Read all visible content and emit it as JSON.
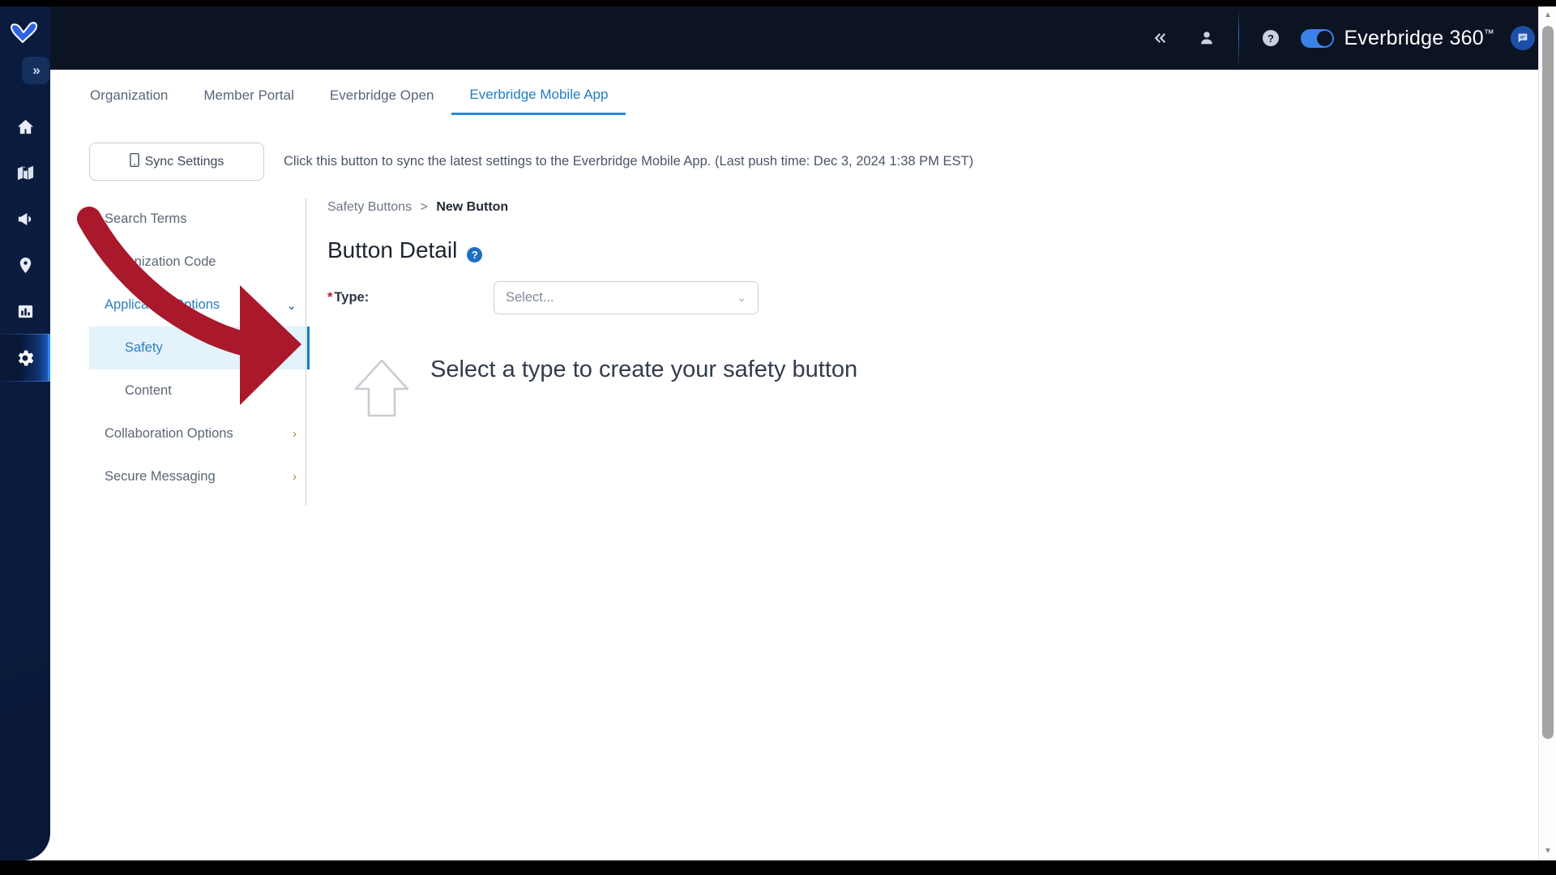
{
  "header": {
    "collapse_icon": "chevron-double-left-icon",
    "user_icon": "user-icon",
    "help_icon": "question-circle-icon",
    "brand_label": "Everbridge 360",
    "brand_sup": "™",
    "chat_icon": "chat-bubble-icon",
    "toggle_state": "on"
  },
  "rail": {
    "logo": "everbridge-logo",
    "expand_label": "»",
    "items": [
      {
        "name": "home-icon",
        "active": false
      },
      {
        "name": "map-icon",
        "active": false
      },
      {
        "name": "megaphone-icon",
        "active": false
      },
      {
        "name": "location-pin-icon",
        "active": false
      },
      {
        "name": "bar-chart-icon",
        "active": false
      },
      {
        "name": "gear-icon",
        "active": true
      }
    ]
  },
  "tabs": [
    {
      "label": "Organization",
      "active": false
    },
    {
      "label": "Member Portal",
      "active": false
    },
    {
      "label": "Everbridge Open",
      "active": false
    },
    {
      "label": "Everbridge Mobile App",
      "active": true
    }
  ],
  "sync": {
    "button_label": "Sync Settings",
    "button_icon": "mobile-phone-icon",
    "note": "Click this button to sync the latest settings to the Everbridge Mobile App. (Last push time: Dec 3, 2024 1:38 PM EST)"
  },
  "subnav": {
    "items": [
      {
        "label": "Search Terms",
        "type": "item",
        "chevron": ""
      },
      {
        "label": "Organization Code",
        "type": "item",
        "chevron": ""
      },
      {
        "label": "Application Options",
        "type": "parent-open",
        "chevron": "⌄"
      },
      {
        "label": "Safety",
        "type": "child-selected",
        "chevron": ""
      },
      {
        "label": "Content",
        "type": "child",
        "chevron": ""
      },
      {
        "label": "Collaboration Options",
        "type": "parent",
        "chevron": "›"
      },
      {
        "label": "Secure Messaging",
        "type": "parent",
        "chevron": "›"
      }
    ]
  },
  "content": {
    "breadcrumb_root": "Safety Buttons",
    "breadcrumb_sep": ">",
    "breadcrumb_current": "New Button",
    "title": "Button Detail",
    "help_icon_glyph": "?",
    "type_required_mark": "*",
    "type_label": "Type:",
    "type_placeholder": "Select...",
    "type_caret": "⌄",
    "hint_icon": "up-arrow-outline-icon",
    "hint_text": "Select a type to create your safety button"
  },
  "annotations": {
    "arrow_color": "#a9192b",
    "box_color": "#a9192b",
    "box_target": "type-field"
  },
  "scrollbar": {
    "up_arrow": "▲",
    "down_arrow": "▼"
  }
}
